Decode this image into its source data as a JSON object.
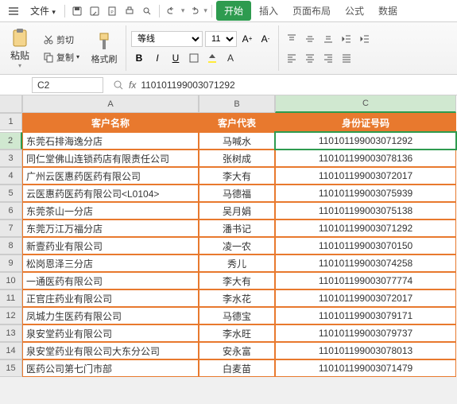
{
  "menu": {
    "file": "文件",
    "tabs": {
      "start": "开始",
      "insert": "插入",
      "layout": "页面布局",
      "formula": "公式",
      "data": "数据"
    }
  },
  "ribbon": {
    "paste": "粘贴",
    "cut": "剪切",
    "copy": "复制",
    "brush": "格式刷",
    "font_name": "等线",
    "font_size": "11"
  },
  "formula_bar": {
    "cell_ref": "C2",
    "fx": "fx",
    "value": "110101199003071292"
  },
  "grid": {
    "col_labels": [
      "A",
      "B",
      "C"
    ],
    "headers": [
      "客户名称",
      "客户代表",
      "身份证号码"
    ],
    "rows": [
      {
        "n": 1
      },
      {
        "n": 2,
        "a": "东莞石排海逸分店",
        "b": "马喊水",
        "c": "110101199003071292"
      },
      {
        "n": 3,
        "a": "同仁堂佛山连锁药店有限责任公司",
        "b": "张树成",
        "c": "110101199003078136"
      },
      {
        "n": 4,
        "a": "广州云医惠药医药有限公司",
        "b": "李大有",
        "c": "110101199003072017"
      },
      {
        "n": 5,
        "a": "云医惠药医药有限公司<L0104>",
        "b": "马德福",
        "c": "110101199003075939"
      },
      {
        "n": 6,
        "a": "东莞茶山一分店",
        "b": "吴月娟",
        "c": "110101199003075138"
      },
      {
        "n": 7,
        "a": "东莞万江万福分店",
        "b": "潘书记",
        "c": "110101199003071292"
      },
      {
        "n": 8,
        "a": "新壹药业有限公司",
        "b": "凌一农",
        "c": "110101199003070150"
      },
      {
        "n": 9,
        "a": "松岗恩泽三分店",
        "b": "秀儿",
        "c": "110101199003074258"
      },
      {
        "n": 10,
        "a": "一通医药有限公司",
        "b": "李大有",
        "c": "110101199003077774"
      },
      {
        "n": 11,
        "a": "正官庄药业有限公司",
        "b": "李水花",
        "c": "110101199003072017"
      },
      {
        "n": 12,
        "a": "凤城力生医药有限公司",
        "b": "马德宝",
        "c": "110101199003079171"
      },
      {
        "n": 13,
        "a": "泉安堂药业有限公司",
        "b": "李水旺",
        "c": "110101199003079737"
      },
      {
        "n": 14,
        "a": "泉安堂药业有限公司大东分公司",
        "b": "安永富",
        "c": "110101199003078013"
      },
      {
        "n": 15,
        "a": "医药公司第七门市部",
        "b": "白麦苗",
        "c": "110101199003071479"
      }
    ],
    "selected_cell": "C2"
  }
}
